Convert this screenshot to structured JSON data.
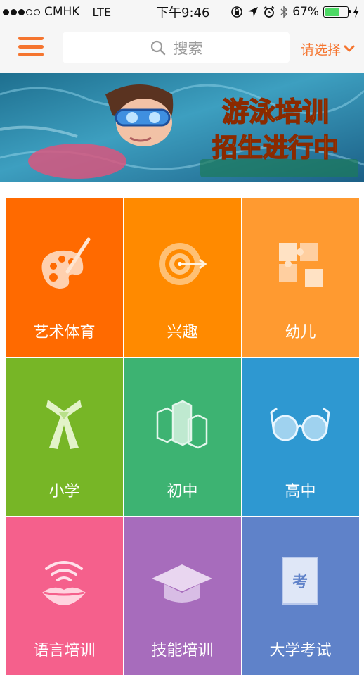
{
  "status_bar": {
    "carrier": "CMHK",
    "network": "LTE",
    "time": "下午9:46",
    "battery_percent": "67%",
    "battery_level": 0.67
  },
  "header": {
    "menu_icon": "hamburger-menu-icon",
    "search_placeholder": "搜索",
    "city_select_label": "请选择"
  },
  "banner": {
    "line1": "游泳培训",
    "line2": "招生进行中"
  },
  "categories": [
    {
      "label": "艺术体育",
      "icon": "palette-icon",
      "color": "#ff6a00"
    },
    {
      "label": "兴趣",
      "icon": "target-icon",
      "color": "#ff8a00"
    },
    {
      "label": "幼儿",
      "icon": "puzzle-icon",
      "color": "#ff9a30"
    },
    {
      "label": "小学",
      "icon": "scarf-icon",
      "color": "#77b626"
    },
    {
      "label": "初中",
      "icon": "blocks-icon",
      "color": "#3db372"
    },
    {
      "label": "高中",
      "icon": "glasses-icon",
      "color": "#2e98d1"
    },
    {
      "label": "语言培训",
      "icon": "lips-icon",
      "color": "#f5608c"
    },
    {
      "label": "技能培训",
      "icon": "graduation-cap-icon",
      "color": "#a76cbc"
    },
    {
      "label": "大学考试",
      "icon": "exam-paper-icon",
      "color": "#5f82c9"
    }
  ],
  "exam_glyph": "考"
}
